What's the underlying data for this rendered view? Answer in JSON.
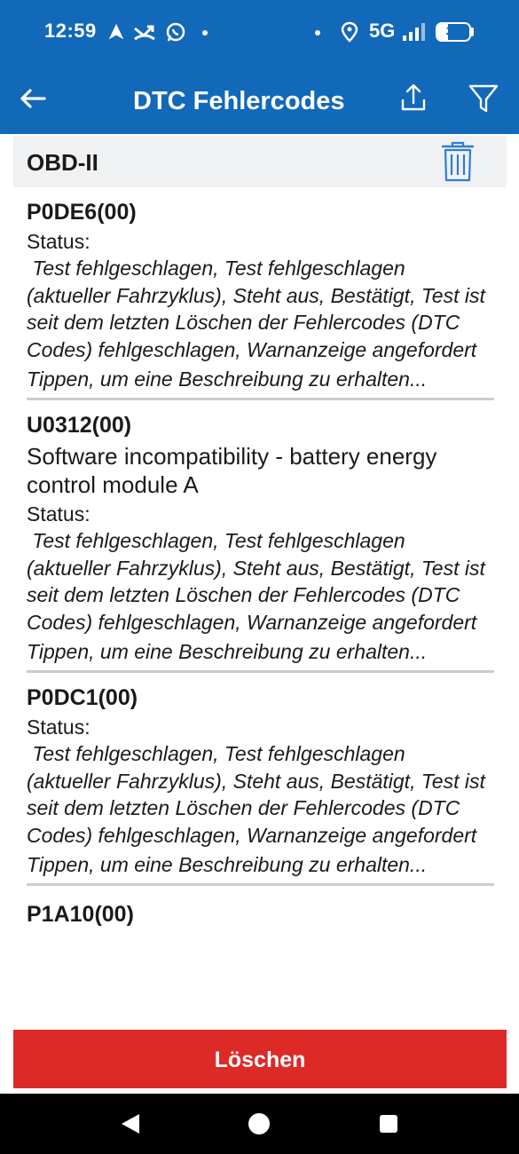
{
  "status_bar": {
    "time": "12:59",
    "network": "5G",
    "battery": "34"
  },
  "app_bar": {
    "title": "DTC Fehlercodes",
    "icons": [
      "back-arrow-icon",
      "share-icon",
      "filter-icon"
    ]
  },
  "section": {
    "label": "OBD-II",
    "icon": "trash-icon"
  },
  "codes": [
    {
      "code": "P0DE6(00)",
      "description": "",
      "status_label": "Status:",
      "status_text": " Test fehlgeschlagen, Test fehlgeschlagen (aktueller Fahrzyklus), Steht aus, Bestätigt, Test ist seit dem letzten Löschen der Fehlercodes (DTC Codes) fehlgeschlagen, Warnanzeige angefordert",
      "hint": "Tippen, um eine Beschreibung zu erhalten..."
    },
    {
      "code": "U0312(00)",
      "description": "Software incompatibility - battery energy control module A",
      "status_label": "Status:",
      "status_text": " Test fehlgeschlagen, Test fehlgeschlagen (aktueller Fahrzyklus), Steht aus, Bestätigt, Test ist seit dem letzten Löschen der Fehlercodes (DTC Codes) fehlgeschlagen, Warnanzeige angefordert",
      "hint": "Tippen, um eine Beschreibung zu erhalten..."
    },
    {
      "code": "P0DC1(00)",
      "description": "",
      "status_label": "Status:",
      "status_text": " Test fehlgeschlagen, Test fehlgeschlagen (aktueller Fahrzyklus), Steht aus, Bestätigt, Test ist seit dem letzten Löschen der Fehlercodes (DTC Codes) fehlgeschlagen, Warnanzeige angefordert",
      "hint": "Tippen, um eine Beschreibung zu erhalten..."
    },
    {
      "code": "P1A10(00)"
    }
  ],
  "delete_button": "Löschen",
  "colors": {
    "primary": "#1268b9",
    "danger": "#dd2a26",
    "section_bg": "#eff1f3"
  }
}
